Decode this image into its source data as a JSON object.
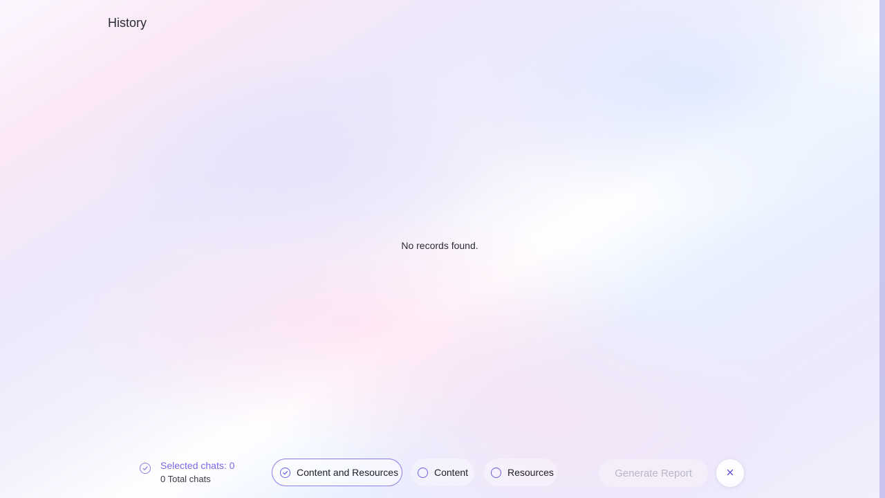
{
  "header": {
    "title": "History"
  },
  "main": {
    "empty_message": "No records found."
  },
  "footer": {
    "selected_label": "Selected chats: 0",
    "total_label": "0 Total chats",
    "options": [
      {
        "label": "Content and Resources",
        "selected": true
      },
      {
        "label": "Content",
        "selected": false
      },
      {
        "label": "Resources",
        "selected": false
      }
    ],
    "generate_label": "Generate Report",
    "generate_enabled": false
  },
  "colors": {
    "accent": "#6c5ce0",
    "disabled_text": "#b9b6c4"
  },
  "icons": {
    "selected_status": "check-circle-icon",
    "option_selected": "check-circle-icon",
    "option_unselected": "radio-circle-icon",
    "close": "close-icon"
  }
}
